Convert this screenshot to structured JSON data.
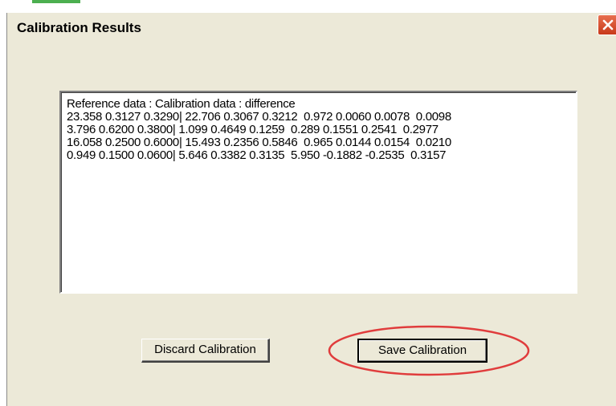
{
  "dialog": {
    "title": "Calibration Results",
    "close_icon": "close-icon"
  },
  "results": {
    "lines": [
      "Reference data : Calibration data : difference",
      "23.358 0.3127 0.3290| 22.706 0.3067 0.3212  0.972 0.0060 0.0078  0.0098",
      "3.796 0.6200 0.3800| 1.099 0.4649 0.1259  0.289 0.1551 0.2541  0.2977",
      "16.058 0.2500 0.6000| 15.493 0.2356 0.5846  0.965 0.0144 0.0154  0.0210",
      "0.949 0.1500 0.0600| 5.646 0.3382 0.3135  5.950 -0.1882 -0.2535  0.3157"
    ]
  },
  "buttons": {
    "discard_label": "Discard Calibration",
    "save_label": "Save Calibration"
  },
  "colors": {
    "dialog_bg": "#ece9d8",
    "close_button": "#d5471f",
    "highlight_ellipse": "#e03c3c"
  }
}
